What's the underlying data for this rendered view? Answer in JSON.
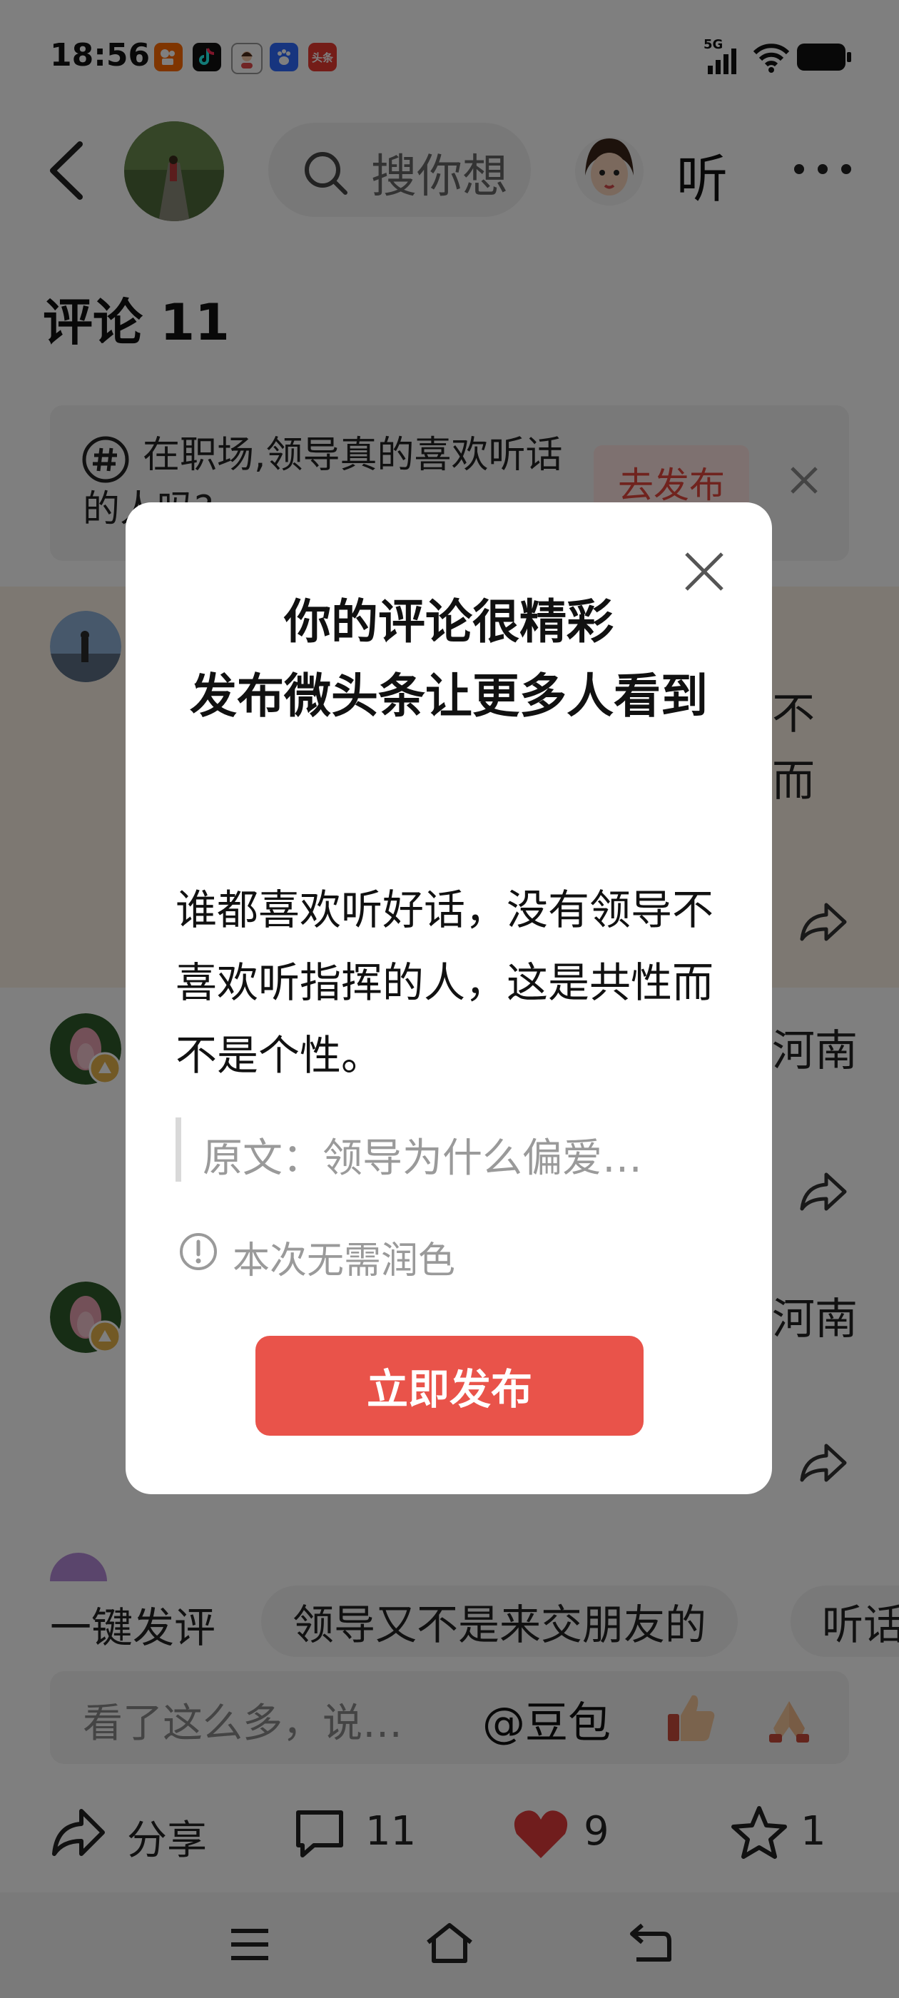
{
  "status_bar": {
    "time": "18:56",
    "network": "5G",
    "app_icons": [
      "kuaishou-icon",
      "douyin-icon",
      "avatar-app-icon",
      "baidu-icon",
      "toutiao-icon"
    ],
    "toutiao_badge": "头条"
  },
  "header": {
    "search_placeholder": "搜你想",
    "listen_label": "听",
    "more_label": "···"
  },
  "comments": {
    "title": "评论 11",
    "topic": {
      "text": "在职场,领导真的喜欢听话的人吗?",
      "publish_label": "去发布"
    },
    "rows": [
      {
        "side_text_1": "不",
        "side_text_2": "而"
      },
      {
        "side_text_1": "河南"
      },
      {
        "side_text_1": "河南"
      }
    ]
  },
  "quick_reply": {
    "label": "一键发评",
    "chips": [
      "领导又不是来交朋友的",
      "听话"
    ]
  },
  "input": {
    "placeholder": "看了这么多，说…",
    "doubao": "@豆包"
  },
  "actions": {
    "share": "分享",
    "comments": "11",
    "likes": "9",
    "favorites": "1"
  },
  "modal": {
    "title_line1": "你的评论很精彩",
    "title_line2": "发布微头条让更多人看到",
    "body": "谁都喜欢听好话，没有领导不喜欢听指挥的人，这是共性而不是个性。",
    "quote": "原文：领导为什么偏爱…",
    "hint": "本次无需润色",
    "publish_button": "立即发布"
  },
  "colors": {
    "accent_red": "#e9534a",
    "heart_red": "#e03a3a",
    "highlight_row": "#fbf1e4"
  }
}
